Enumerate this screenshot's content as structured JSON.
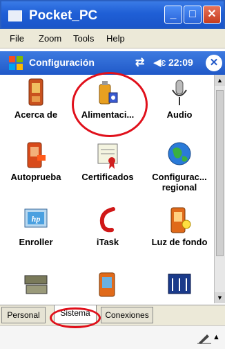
{
  "window": {
    "title": "Pocket_PC",
    "min": "_",
    "max": "□",
    "close": "✕"
  },
  "menu": {
    "file": "File",
    "zoom": "Zoom",
    "tools": "Tools",
    "help": "Help"
  },
  "navbar": {
    "title": "Configuración",
    "time": "22:09",
    "ok": "✕",
    "sync_icon": "⇄",
    "volume_icon": "◀ɛ"
  },
  "items": [
    {
      "label": "Acerca de",
      "icon": "pda-icon"
    },
    {
      "label": "Alimentaci...",
      "icon": "battery-icon"
    },
    {
      "label": "Audio",
      "icon": "microphone-icon"
    },
    {
      "label": "Autoprueba",
      "icon": "selftest-icon"
    },
    {
      "label": "Certificados",
      "icon": "certificate-icon"
    },
    {
      "label": "Configurac...",
      "label2": "regional",
      "icon": "globe-icon"
    },
    {
      "label": "Enroller",
      "icon": "hp-icon"
    },
    {
      "label": "iTask",
      "icon": "itask-icon"
    },
    {
      "label": "Luz de fondo",
      "icon": "backlight-icon"
    },
    {
      "label": "",
      "icon": "memory-icon"
    },
    {
      "label": "",
      "icon": "screen-icon"
    },
    {
      "label": "",
      "icon": "profile-icon"
    }
  ],
  "tabs": [
    "Personal",
    "Sistema",
    "Conexiones"
  ],
  "colors": {
    "accent": "#1f5fd6",
    "annotation": "#e0101b"
  }
}
